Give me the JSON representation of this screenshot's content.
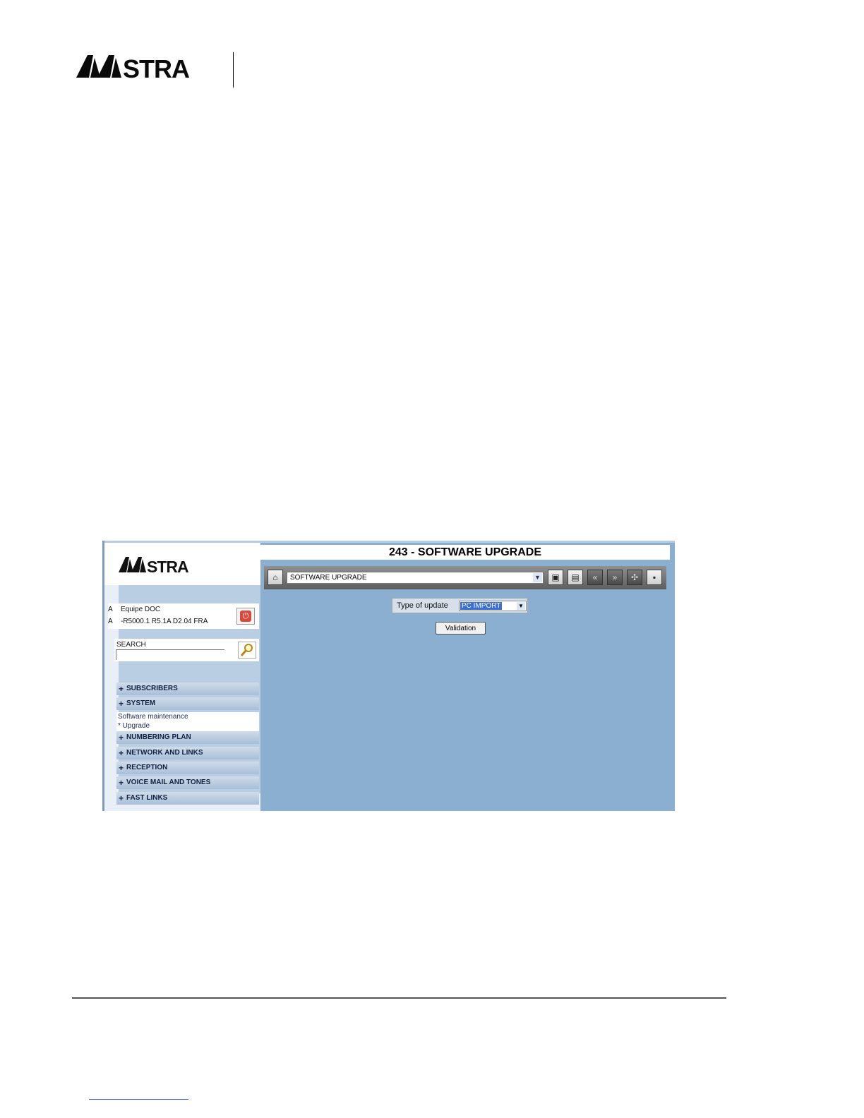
{
  "document": {
    "brand": "AASTRA"
  },
  "app": {
    "brand": "AASTRA",
    "page_title": "243 - SOFTWARE UPGRADE",
    "user": {
      "line1_prefix": "A",
      "line1": "Equipe DOC",
      "line2_prefix": "A",
      "line2": "-R5000.1 R5.1A D2.04 FRA"
    },
    "search": {
      "label": "SEARCH",
      "value": ""
    },
    "menu": [
      {
        "label": "SUBSCRIBERS"
      },
      {
        "label": "SYSTEM"
      },
      {
        "label": "NUMBERING PLAN"
      },
      {
        "label": "NETWORK AND LINKS"
      },
      {
        "label": "RECEPTION"
      },
      {
        "label": "VOICE MAIL AND TONES"
      },
      {
        "label": "FAST LINKS"
      }
    ],
    "submenu": {
      "line1": "Software maintenance",
      "line2": "* Upgrade"
    },
    "toolbar": {
      "select_value": "SOFTWARE UPGRADE"
    },
    "form": {
      "type_label": "Type of update",
      "type_value": "PC IMPORT",
      "validate_label": "Validation"
    },
    "colors": {
      "background": "#8aafd0",
      "sidebar": "#e9eff6",
      "selection": "#3b6fd6"
    }
  }
}
